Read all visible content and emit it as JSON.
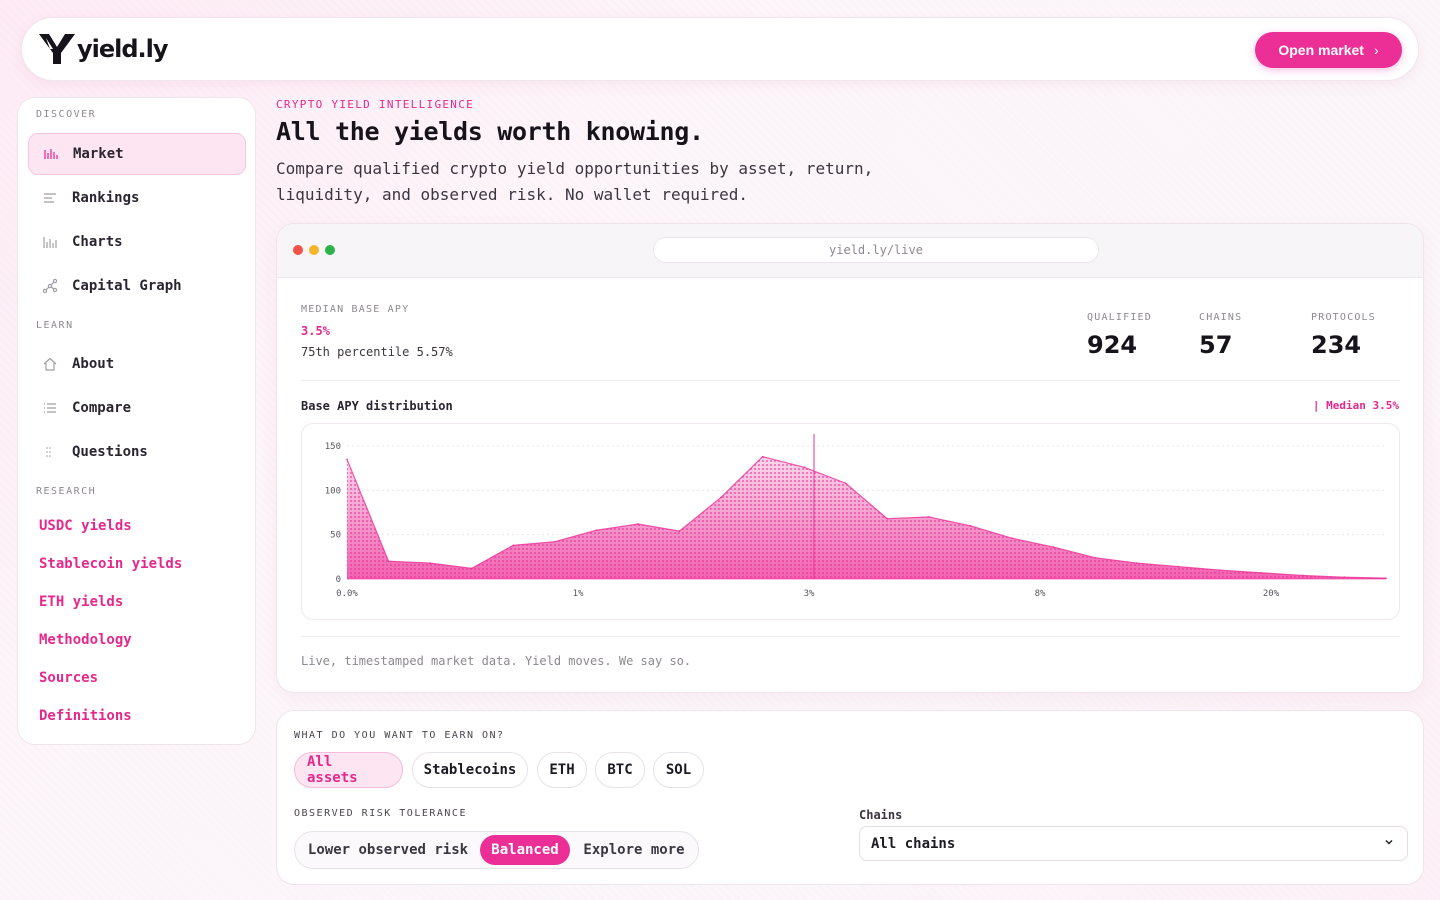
{
  "brand": {
    "name": "yield.ly"
  },
  "header": {
    "cta_label": "Open market"
  },
  "sidebar": {
    "sections": {
      "discover": "DISCOVER",
      "learn": "LEARN",
      "research": "RESEARCH"
    },
    "discover": [
      {
        "label": "Market",
        "icon": "bar-chart-icon",
        "active": true
      },
      {
        "label": "Rankings",
        "icon": "list-icon"
      },
      {
        "label": "Charts",
        "icon": "chart-icon"
      },
      {
        "label": "Capital Graph",
        "icon": "graph-icon"
      }
    ],
    "learn": [
      {
        "label": "About",
        "icon": "home-icon"
      },
      {
        "label": "Compare",
        "icon": "list-compare-icon"
      },
      {
        "label": "Questions",
        "icon": "grid-icon"
      }
    ],
    "research": [
      "USDC yields",
      "Stablecoin yields",
      "ETH yields",
      "Methodology",
      "Sources",
      "Definitions"
    ]
  },
  "hero": {
    "eyebrow": "CRYPTO YIELD INTELLIGENCE",
    "title": "All the yields worth knowing.",
    "subtitle": "Compare qualified crypto yield opportunities by asset, return, liquidity, and observed risk. No wallet required."
  },
  "browser": {
    "url": "yield.ly/live",
    "median_label": "MEDIAN BASE APY",
    "median_value": "3.5%",
    "percentile": "75th percentile 5.57%",
    "stats": [
      {
        "label": "QUALIFIED",
        "value": "924"
      },
      {
        "label": "CHAINS",
        "value": "57"
      },
      {
        "label": "PROTOCOLS",
        "value": "234"
      }
    ],
    "dist_title": "Base APY distribution",
    "median_legend": "| Median 3.5%",
    "footnote": "Live, timestamped market data. Yield moves. We say so."
  },
  "chart_data": {
    "type": "area",
    "title": "Base APY distribution",
    "x_tick_labels": [
      "0.0%",
      "1%",
      "3%",
      "8%",
      "20%"
    ],
    "y_ticks": [
      0,
      50,
      100,
      150
    ],
    "ylim": [
      0,
      150
    ],
    "median_line_label": "Median 3.5%",
    "x": [
      0,
      4,
      8,
      12,
      16,
      20,
      24,
      28,
      32,
      36,
      40,
      44,
      48,
      52,
      56,
      60,
      64,
      68,
      72,
      76,
      80,
      84,
      88,
      92,
      96,
      100
    ],
    "x_note": "relative position along log-scaled axis, 0 = 0.0%, 100 = 20%+",
    "values": [
      135,
      20,
      18,
      12,
      38,
      42,
      55,
      62,
      54,
      92,
      138,
      126,
      108,
      68,
      70,
      60,
      46,
      36,
      24,
      18,
      14,
      10,
      7,
      4,
      2,
      1
    ],
    "color": "#ec2f96"
  },
  "filters": {
    "earn_label": "WHAT DO YOU WANT TO EARN ON?",
    "assets": [
      "All assets",
      "Stablecoins",
      "ETH",
      "BTC",
      "SOL"
    ],
    "risk_label": "OBSERVED RISK TOLERANCE",
    "risk_options": [
      "Lower observed risk",
      "Balanced",
      "Explore more"
    ],
    "chains_label": "Chains",
    "chains_value": "All chains"
  },
  "colors": {
    "accent": "#ec2f96",
    "accent_soft": "#fde5f1"
  }
}
